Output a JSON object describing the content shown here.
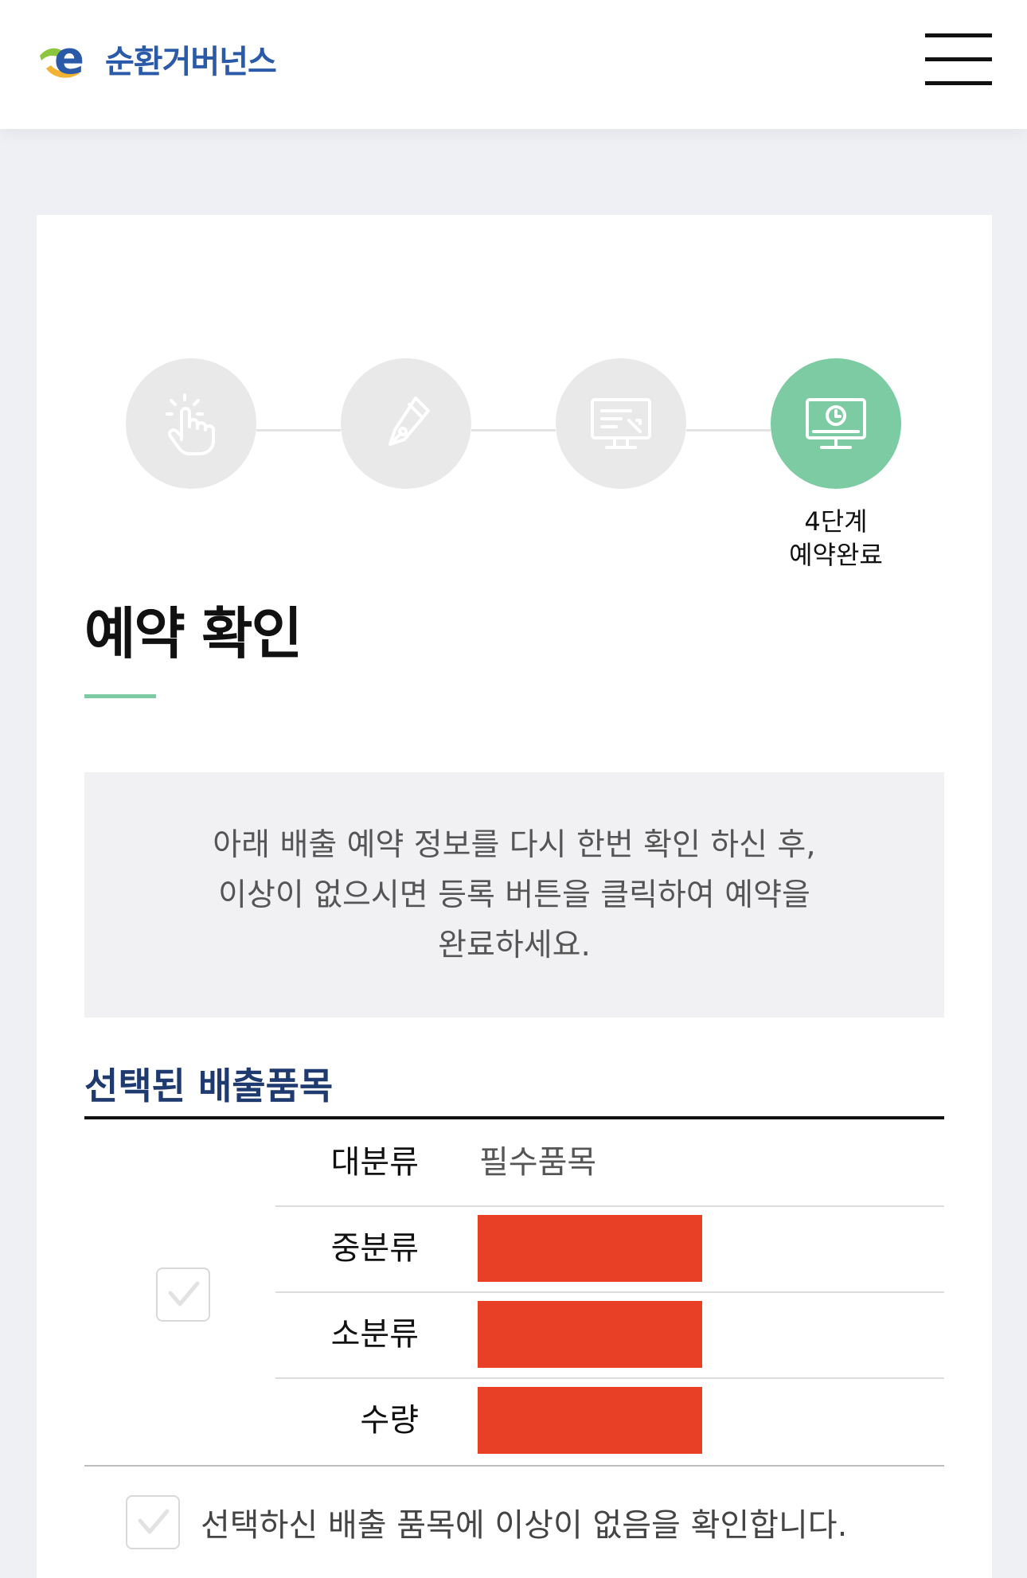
{
  "header": {
    "logo_text": "순환거버넌스",
    "logo_letter": "e",
    "menu_icon": "hamburger-menu-icon"
  },
  "steps": [
    {
      "icon": "hand-pointer-icon",
      "active": false
    },
    {
      "icon": "pen-nib-icon",
      "active": false
    },
    {
      "icon": "monitor-edit-icon",
      "active": false
    },
    {
      "icon": "monitor-clock-icon",
      "active": true,
      "label_line1": "4단계",
      "label_line2": "예약완료"
    }
  ],
  "page": {
    "title": "예약 확인",
    "notice": "아래 배출 예약 정보를 다시 한번 확인 하신 후,\n이상이 없으시면 등록 버튼을 클릭하여 예약을\n완료하세요."
  },
  "section": {
    "title": "선택된 배출품목"
  },
  "item_table": {
    "rows": [
      {
        "key": "대분류",
        "value": "필수품목"
      },
      {
        "key": "중분류",
        "value": ""
      },
      {
        "key": "소분류",
        "value": ""
      },
      {
        "key": "수량",
        "value": ""
      }
    ]
  },
  "confirm": {
    "label": "선택하신 배출 품목에 이상이 없음을 확인합니다."
  },
  "colors": {
    "accent": "#7ccba2",
    "brand_blue": "#2a5aa8",
    "section_title": "#1f3a6e",
    "redaction": "#e84027"
  }
}
